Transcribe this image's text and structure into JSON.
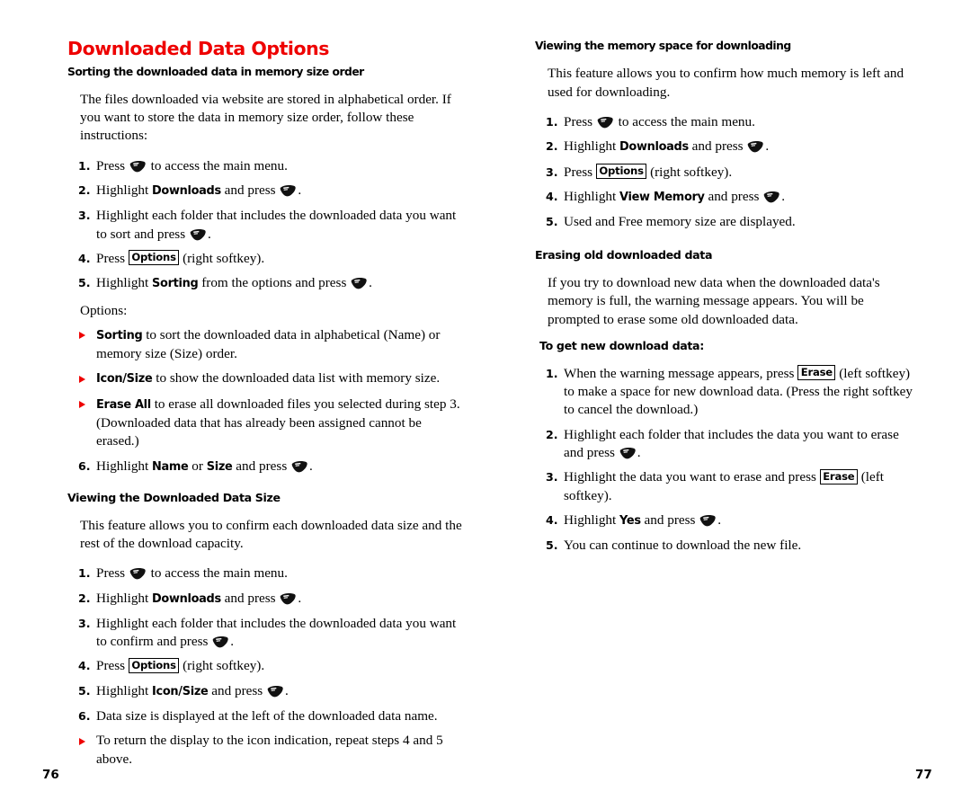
{
  "document": {
    "title": "Downloaded Data Options",
    "title_color": "#ee0000",
    "bullet_color": "#ee0000"
  },
  "icons": {
    "menu_key": "phone-menu-key-icon"
  },
  "left_page": {
    "page_number": "76",
    "sections": [
      {
        "heading": "Sorting the downloaded data in memory size order",
        "intro": "The files downloaded via website are stored in alphabetical order. If you want to store the data in memory size order, follow these instructions:",
        "steps": [
          {
            "num": "1.",
            "pre": "Press",
            "post": "to access the main menu."
          },
          {
            "num": "2.",
            "pre": "Highlight",
            "kw": "Downloads",
            "mid": "and press",
            "post": "."
          },
          {
            "num": "3.",
            "pre": "Highlight each folder that includes the downloaded data you want to sort and press",
            "post": "."
          },
          {
            "num": "4.",
            "pre": "Press",
            "softkey": "Options",
            "post": "(right softkey)."
          },
          {
            "num": "5.",
            "pre": "Highlight",
            "kw": "Sorting",
            "mid": "from the options and press",
            "post": "."
          }
        ],
        "options_label": "Options:",
        "bullets": [
          {
            "kw": "Sorting",
            "text": "to sort the downloaded data in alphabetical (Name) or memory size (Size) order."
          },
          {
            "kw": "Icon/Size",
            "text": "to show the downloaded data list with memory size."
          },
          {
            "kw": "Erase All",
            "text": "to erase all downloaded files you selected during step 3. (Downloaded data that has already been assigned cannot be erased.)"
          }
        ],
        "final_step": {
          "num": "6.",
          "pre": "Highlight",
          "kw1": "Name",
          "mid1": "or",
          "kw2": "Size",
          "mid2": "and press",
          "post": "."
        }
      },
      {
        "heading": "Viewing the Downloaded Data Size",
        "intro": "This feature allows you to confirm each downloaded data size and the rest of the download capacity.",
        "steps": [
          {
            "num": "1.",
            "pre": "Press",
            "post": "to access the main menu."
          },
          {
            "num": "2.",
            "pre": "Highlight",
            "kw": "Downloads",
            "mid": "and press",
            "post": "."
          },
          {
            "num": "3.",
            "pre": "Highlight each folder that includes the downloaded data you want to confirm and press",
            "post": "."
          },
          {
            "num": "4.",
            "pre": "Press",
            "softkey": "Options",
            "post": "(right softkey)."
          },
          {
            "num": "5.",
            "pre": "Highlight",
            "kw": "Icon/Size",
            "mid": "and press",
            "post": "."
          },
          {
            "num": "6.",
            "pre": "Data size is displayed at the left of the downloaded data name."
          }
        ],
        "trailing_bullet": "To return the display to the icon indication, repeat steps 4 and 5 above."
      }
    ]
  },
  "right_page": {
    "page_number": "77",
    "sections": [
      {
        "heading": "Viewing the memory space for downloading",
        "intro": "This feature allows you to confirm how much memory is left and used for downloading.",
        "steps": [
          {
            "num": "1.",
            "pre": "Press",
            "post": "to access the main menu."
          },
          {
            "num": "2.",
            "pre": "Highlight",
            "kw": "Downloads",
            "mid": "and press",
            "post": "."
          },
          {
            "num": "3.",
            "pre": "Press",
            "softkey": "Options",
            "post": "(right softkey)."
          },
          {
            "num": "4.",
            "pre": "Highlight",
            "kw": "View Memory",
            "mid": "and press",
            "post": "."
          },
          {
            "num": "5.",
            "pre": "Used and Free memory size are displayed."
          }
        ]
      },
      {
        "heading": "Erasing old downloaded data",
        "intro": "If you try to download new data when the downloaded data's memory is full, the warning message appears. You will be prompted to erase some old downloaded data.",
        "subheading": "To get new download data:",
        "steps": [
          {
            "num": "1.",
            "pre": "When the warning message appears, press",
            "softkey": "Erase",
            "post": "(left softkey) to make a space for new download data. (Press the right softkey to cancel the download.)"
          },
          {
            "num": "2.",
            "pre": "Highlight each folder that includes the data you want to erase and press",
            "post": "."
          },
          {
            "num": "3.",
            "pre": "Highlight the data you want to erase and press",
            "softkey": "Erase",
            "post": "(left softkey)."
          },
          {
            "num": "4.",
            "pre": "Highlight",
            "kw": "Yes",
            "mid": "and press",
            "post": "."
          },
          {
            "num": "5.",
            "pre": "You can continue to download the new file."
          }
        ]
      }
    ]
  }
}
